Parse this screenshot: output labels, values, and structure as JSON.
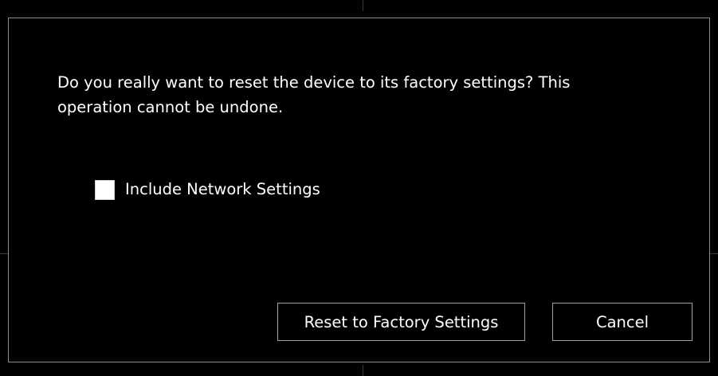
{
  "dialog": {
    "message": "Do you really want to reset the device to its factory settings?  This\noperation cannot be undone.",
    "checkbox": {
      "label": "Include Network Settings",
      "checked": false
    },
    "buttons": {
      "reset_label": "Reset to Factory Settings",
      "cancel_label": "Cancel"
    }
  },
  "colors": {
    "background": "#000000",
    "text": "#ffffff",
    "border": "#8a8a8a"
  }
}
